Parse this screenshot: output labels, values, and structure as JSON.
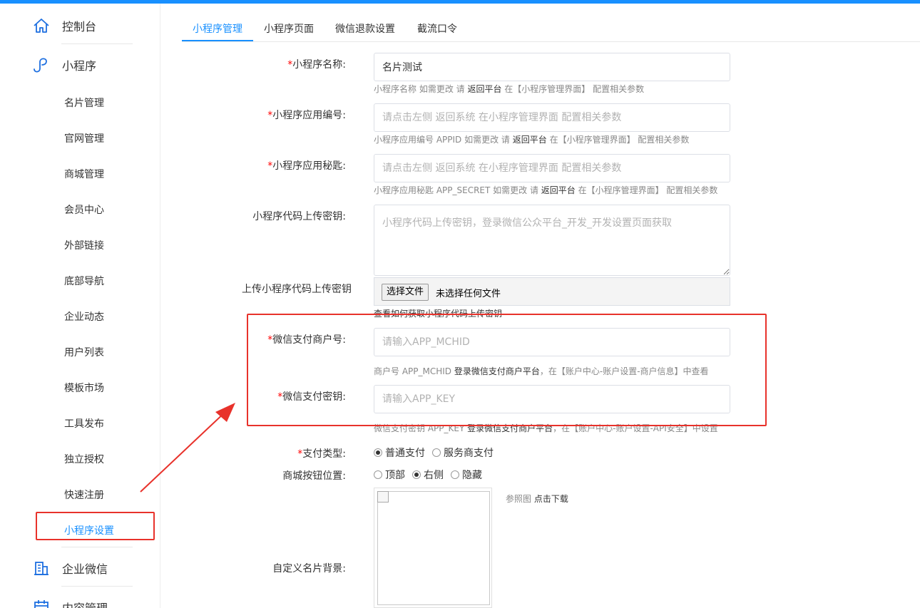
{
  "sidebar": {
    "main_items": [
      {
        "label": "控制台",
        "icon": "home-icon"
      },
      {
        "label": "小程序",
        "icon": "miniprogram-icon"
      },
      {
        "label": "企业微信",
        "icon": "building-icon"
      },
      {
        "label": "内容管理",
        "icon": "calendar-icon"
      }
    ],
    "sub_items": [
      "名片管理",
      "官网管理",
      "商城管理",
      "会员中心",
      "外部链接",
      "底部导航",
      "企业动态",
      "用户列表",
      "模板市场",
      "工具发布",
      "独立授权",
      "快速注册",
      "小程序设置"
    ],
    "active_sub": "小程序设置"
  },
  "tabs": [
    "小程序管理",
    "小程序页面",
    "微信退款设置",
    "截流口令"
  ],
  "form": {
    "name": {
      "label": "小程序名称:",
      "value": "名片测试",
      "hint_pre": "小程序名称 如需更改 请 ",
      "hint_link": "返回平台",
      "hint_post": " 在【小程序管理界面】 配置相关参数"
    },
    "appid": {
      "label": "小程序应用编号:",
      "placeholder": "请点击左侧 返回系统 在小程序管理界面 配置相关参数",
      "hint_pre": "小程序应用编号 APPID 如需更改 请 ",
      "hint_link": "返回平台",
      "hint_post": " 在【小程序管理界面】 配置相关参数"
    },
    "secret": {
      "label": "小程序应用秘匙:",
      "placeholder": "请点击左侧 返回系统 在小程序管理界面 配置相关参数",
      "hint_pre": "小程序应用秘匙 APP_SECRET 如需更改 请 ",
      "hint_link": "返回平台",
      "hint_post": " 在【小程序管理界面】 配置相关参数"
    },
    "upload_key": {
      "label": "小程序代码上传密钥:",
      "placeholder": "小程序代码上传密钥，登录微信公众平台_开发_开发设置页面获取"
    },
    "upload_file": {
      "label": "上传小程序代码上传密钥",
      "button": "选择文件",
      "status": "未选择任何文件",
      "hint": "查看如何获取小程序代码上传密钥"
    },
    "mchid": {
      "label": "微信支付商户号:",
      "placeholder": "请输入APP_MCHID",
      "hint_pre": "商户号 APP_MCHID ",
      "hint_link": "登录微信支付商户平台",
      "hint_post": "，在【账户中心-账户设置-商户信息】中查看"
    },
    "apikey": {
      "label": "微信支付密钥:",
      "placeholder": "请输入APP_KEY",
      "hint_pre": "微信支付密钥 APP_KEY ",
      "hint_link": "登录微信支付商户平台",
      "hint_post": "，在【账户中心-账户设置-API安全】中设置"
    },
    "pay_type": {
      "label": "支付类型:",
      "options": [
        "普通支付",
        "服务商支付"
      ],
      "selected": "普通支付"
    },
    "mall_btn": {
      "label": "商城按钮位置:",
      "options": [
        "顶部",
        "右侧",
        "隐藏"
      ],
      "selected": "右侧"
    },
    "bg": {
      "label": "自定义名片背景:",
      "ref_pre": "参照图 ",
      "ref_link": "点击下载"
    },
    "required_mark": "*"
  },
  "colors": {
    "accent": "#1890ff",
    "annotation": "#e8322b",
    "required": "#ff0000"
  }
}
